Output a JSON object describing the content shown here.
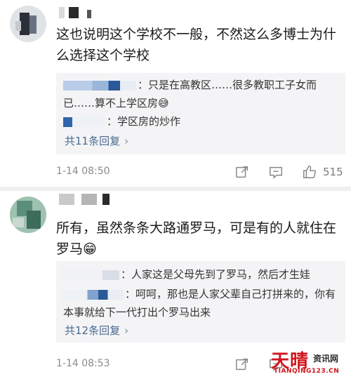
{
  "comments": [
    {
      "text": "这也说明这个学校不一般，不然这么多博士为什么选择这个学校",
      "replies": [
        {
          "text": "：只是在高教区……很多教职工子女而已……算不上学区房",
          "emoji": "😅"
        },
        {
          "text": "：学区房的炒作"
        }
      ],
      "more_replies": "共11条回复",
      "time": "1-14 08:50",
      "like_count": "515"
    },
    {
      "text": "所有，虽然条条大路通罗马，可是有的人就住在罗马",
      "emoji": "😁",
      "replies": [
        {
          "text": "：人家这是父母先到了罗马，然后才生娃"
        },
        {
          "text": "：呵呵，那也是人家父辈自己打拼来的，你有本事就给下一代打出个罗马出来"
        }
      ],
      "more_replies": "共12条回复",
      "time": "1-14 08:53",
      "like_count": ""
    }
  ],
  "icons": {
    "repost": "repost-icon",
    "comment": "comment-icon",
    "like": "thumbs-up-icon",
    "more": "chevron-right-icon"
  },
  "colors": {
    "link": "#4a6a90",
    "meta": "#8a8a8a",
    "reply_bg": "#f4f4f6",
    "watermark_red": "#d0141c"
  },
  "watermark": {
    "big": "天晴",
    "small": "资讯网",
    "url": "TIANQING123.CN"
  }
}
